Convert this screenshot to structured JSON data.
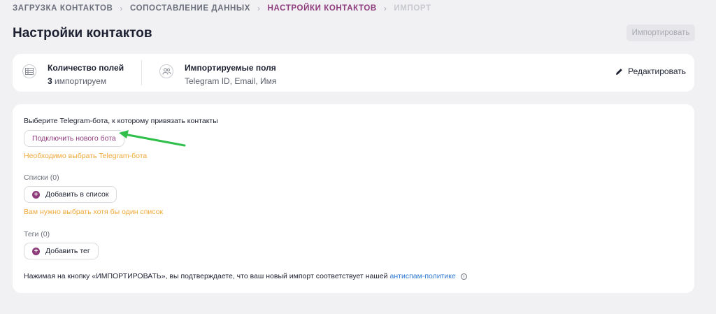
{
  "breadcrumb": {
    "step1": "Загрузка контактов",
    "step2": "Сопоставление данных",
    "step3": "Настройки контактов",
    "step4": "Импорт"
  },
  "header": {
    "title": "Настройки контактов",
    "import_button": "Импортировать"
  },
  "summary": {
    "fields_title": "Количество полей",
    "fields_count": "3",
    "fields_suffix": "импортируем",
    "imported_title": "Импортируемые поля",
    "imported_list": "Telegram ID, Email, Имя",
    "edit_label": "Редактировать"
  },
  "bot": {
    "label": "Выберите Telegram-бота, к которому привязать контакты",
    "connect_button": "Подключить нового бота",
    "warning": "Необходимо выбрать Telegram-бота"
  },
  "lists": {
    "label": "Списки (0)",
    "add_button": "Добавить в список",
    "warning": "Вам нужно выбрать хотя бы один список"
  },
  "tags": {
    "label": "Теги (0)",
    "add_button": "Добавить тег"
  },
  "consent": {
    "text": "Нажимая на кнопку «ИМПОРТИРОВАТЬ», вы подтверждаете, что ваш новый импорт соответствует нашей",
    "link": "антиспам-политике"
  },
  "colors": {
    "accent": "#8e3b7c",
    "warning": "#f0a93a",
    "link": "#2f77d1",
    "annotation_arrow": "#2fbf4a"
  }
}
